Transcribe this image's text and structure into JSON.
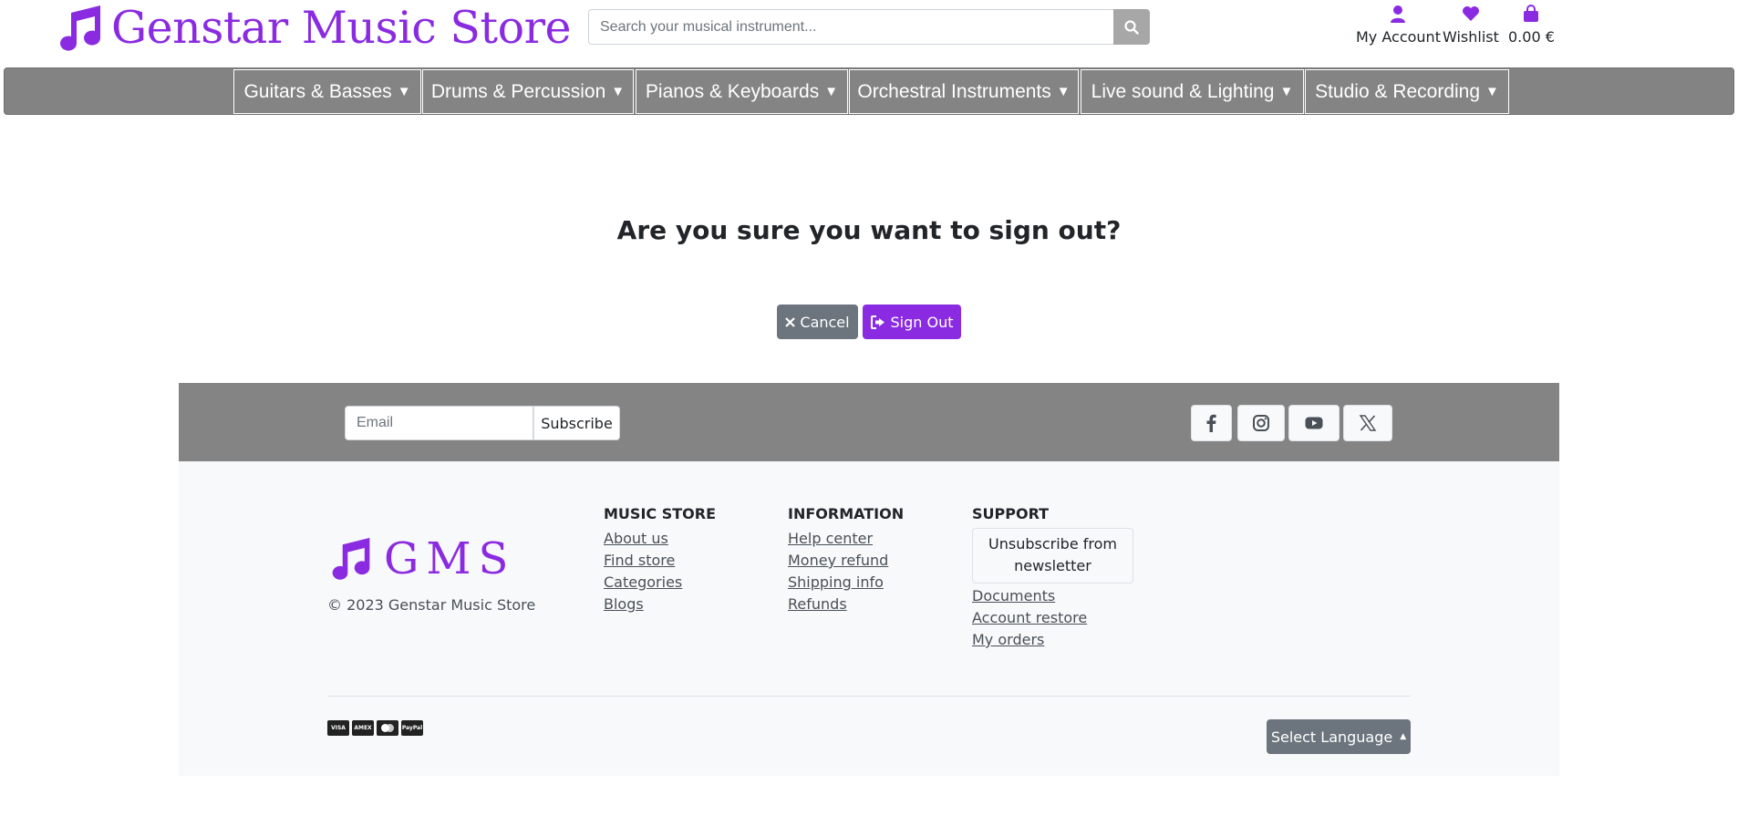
{
  "header": {
    "brand": "Genstar Music Store",
    "search_placeholder": "Search your musical instrument...",
    "account_label": "My Account",
    "wishlist_label": "Wishlist",
    "cart_total": "0.00 €"
  },
  "nav": {
    "items": [
      {
        "label": "Guitars & Basses"
      },
      {
        "label": "Drums & Percussion"
      },
      {
        "label": "Pianos & Keyboards"
      },
      {
        "label": "Orchestral Instruments"
      },
      {
        "label": "Live sound & Lighting"
      },
      {
        "label": "Studio & Recording"
      }
    ]
  },
  "main": {
    "title": "Are you sure you want to sign out?",
    "cancel_label": "Cancel",
    "signout_label": "Sign Out"
  },
  "footer": {
    "email_placeholder": "Email",
    "subscribe_label": "Subscribe",
    "brand_short": "GMS",
    "copyright": "© 2023 Genstar Music Store",
    "music_store": {
      "heading": "MUSIC STORE",
      "links": [
        "About us",
        "Find store",
        "Categories",
        "Blogs"
      ]
    },
    "information": {
      "heading": "INFORMATION",
      "links": [
        "Help center",
        "Money refund",
        "Shipping info",
        "Refunds"
      ]
    },
    "support": {
      "heading": "SUPPORT",
      "unsubscribe": "Unsubscribe from newsletter",
      "links": [
        "Documents",
        "Account restore",
        "My orders"
      ]
    },
    "language_label": "Select Language",
    "payment_cards": [
      "VISA",
      "AMEX",
      "MC",
      "PayPal"
    ]
  },
  "colors": {
    "brand": "#8a2be2",
    "nav_bg": "#848484",
    "secondary": "#6c757d"
  }
}
